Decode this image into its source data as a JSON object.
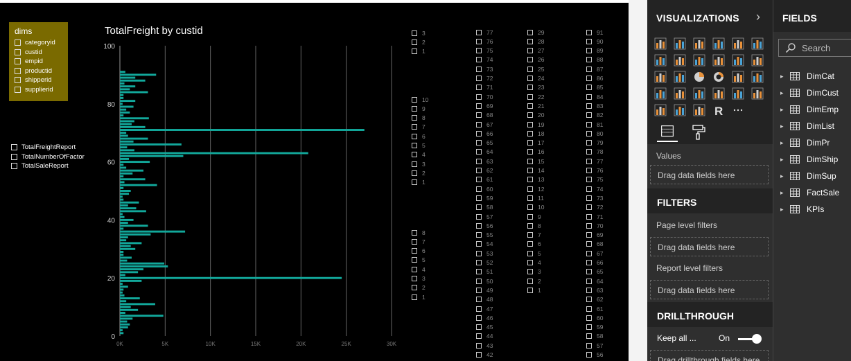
{
  "dims_slicer": {
    "title": "dims",
    "items": [
      "categoryid",
      "custid",
      "empid",
      "productid",
      "shipperid",
      "supplierid"
    ]
  },
  "reports_slicer": {
    "items": [
      "TotalFreightReport",
      "TotalNumberOfFactor",
      "TotalSaleReport"
    ]
  },
  "chart_data": {
    "type": "bar",
    "title": "TotalFreight by custid",
    "orientation": "horizontal",
    "color": "#12a89b",
    "xlim": [
      0,
      30000
    ],
    "xticks": [
      "0K",
      "5K",
      "10K",
      "15K",
      "20K",
      "25K",
      "30K"
    ],
    "ylim": [
      0,
      100
    ],
    "yticks": [
      "0",
      "20",
      "40",
      "60",
      "80",
      "100"
    ],
    "grid": true,
    "categories": [
      1,
      2,
      3,
      4,
      5,
      6,
      7,
      8,
      9,
      10,
      11,
      12,
      13,
      14,
      15,
      16,
      17,
      18,
      19,
      20,
      21,
      22,
      23,
      24,
      25,
      26,
      27,
      28,
      29,
      30,
      31,
      32,
      33,
      34,
      35,
      36,
      37,
      38,
      39,
      40,
      41,
      42,
      43,
      44,
      45,
      46,
      47,
      48,
      49,
      50,
      51,
      52,
      53,
      54,
      55,
      56,
      57,
      58,
      59,
      60,
      61,
      62,
      63,
      64,
      65,
      66,
      67,
      68,
      69,
      70,
      71,
      72,
      73,
      74,
      75,
      76,
      77,
      78,
      79,
      80,
      81,
      82,
      83,
      84,
      85,
      86,
      87,
      88,
      89,
      90,
      91
    ],
    "values": [
      400,
      300,
      900,
      1100,
      800,
      1400,
      4800,
      600,
      2000,
      1200,
      3900,
      700,
      2200,
      500,
      300,
      400,
      900,
      300,
      2400,
      24500,
      600,
      2000,
      2600,
      5300,
      4900,
      800,
      1300,
      400,
      400,
      1700,
      1200,
      2400,
      700,
      900,
      3400,
      7200,
      400,
      3100,
      900,
      1500,
      500,
      300,
      2900,
      1800,
      900,
      2100,
      400,
      300,
      1000,
      1200,
      400,
      4100,
      500,
      2800,
      400,
      1400,
      2600,
      700,
      400,
      3300,
      1000,
      7000,
      20800,
      1600,
      800,
      6800,
      1500,
      3100,
      900,
      700,
      27000,
      2800,
      1300,
      1600,
      3200,
      400,
      1100,
      700,
      1500,
      300,
      1700,
      400,
      400,
      3100,
      1100,
      1700,
      500,
      2800,
      1700,
      4000,
      600
    ]
  },
  "slicers": [
    {
      "col": "A",
      "groups": [
        [
          "3",
          "2",
          "1"
        ],
        [
          "10",
          "9",
          "8",
          "7",
          "6",
          "5",
          "4",
          "3",
          "2",
          "1"
        ],
        [
          "8",
          "7",
          "6",
          "5",
          "4",
          "3",
          "2",
          "1"
        ]
      ]
    },
    {
      "col": "B",
      "items": [
        "77",
        "76",
        "75",
        "74",
        "73",
        "72",
        "71",
        "70",
        "69",
        "68",
        "67",
        "66",
        "65",
        "64",
        "63",
        "62",
        "61",
        "60",
        "59",
        "58",
        "57",
        "56",
        "55",
        "54",
        "53",
        "52",
        "51",
        "50",
        "49",
        "48",
        "47",
        "46",
        "45",
        "44",
        "43",
        "42"
      ]
    },
    {
      "col": "C",
      "items": [
        "29",
        "28",
        "27",
        "26",
        "25",
        "24",
        "23",
        "22",
        "21",
        "20",
        "19",
        "18",
        "17",
        "16",
        "15",
        "14",
        "13",
        "12",
        "11",
        "10",
        "9",
        "8",
        "7",
        "6",
        "5",
        "4",
        "3",
        "2",
        "1"
      ]
    },
    {
      "col": "D",
      "items": [
        "91",
        "90",
        "89",
        "88",
        "87",
        "86",
        "85",
        "84",
        "83",
        "82",
        "81",
        "80",
        "79",
        "78",
        "77",
        "76",
        "75",
        "74",
        "73",
        "72",
        "71",
        "70",
        "69",
        "68",
        "67",
        "66",
        "65",
        "64",
        "63",
        "62",
        "61",
        "60",
        "59",
        "58",
        "57",
        "56"
      ]
    }
  ],
  "visualizations": {
    "title": "VISUALIZATIONS",
    "values_label": "Values",
    "values_drop": "Drag data fields here",
    "filters_title": "FILTERS",
    "page_filters": "Page level filters",
    "page_drop": "Drag data fields here",
    "report_filters": "Report level filters",
    "report_drop": "Drag data fields here",
    "drill_title": "DRILLTHROUGH",
    "keep_all": "Keep all ...",
    "toggle": "On",
    "drill_drop": "Drag drillthrough fields here"
  },
  "fields": {
    "title": "FIELDS",
    "search_placeholder": "Search",
    "tables": [
      "DimCat",
      "DimCust",
      "DimEmp",
      "DimList",
      "DimPr",
      "DimShip",
      "DimSup",
      "FactSale",
      "KPIs"
    ]
  }
}
